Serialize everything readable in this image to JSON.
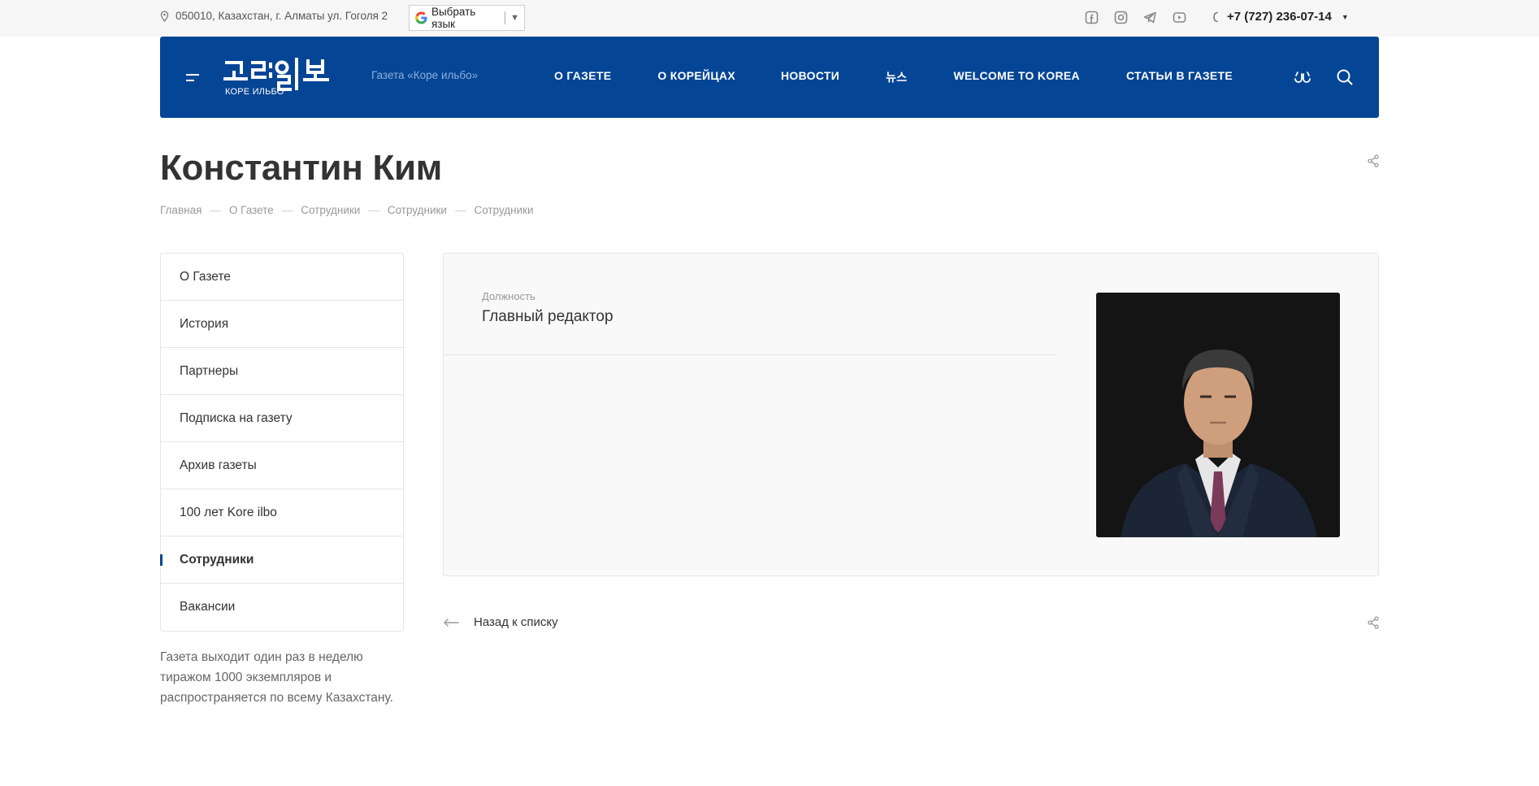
{
  "topbar": {
    "address": "050010, Казахстан, г. Алматы ул. Гоголя 2",
    "language_label": "Выбрать язык",
    "phone": "+7 (727) 236-07-14",
    "social_icons": [
      "facebook-icon",
      "instagram-icon",
      "telegram-icon",
      "youtube-icon"
    ]
  },
  "header": {
    "logo_sub": "КОРЕ ИЛЬБО",
    "tagline": "Газета «Коре ильбо»",
    "menu": [
      {
        "label": "О ГАЗЕТЕ"
      },
      {
        "label": "О КОРЕЙЦАХ"
      },
      {
        "label": "НОВОСТИ"
      },
      {
        "label": "뉴스"
      },
      {
        "label": "WELCOME TO KOREA"
      },
      {
        "label": "СТАТЬИ В ГАЗЕТЕ"
      }
    ]
  },
  "page": {
    "title": "Константин Ким",
    "breadcrumb": [
      "Главная",
      "О Газете",
      "Сотрудники",
      "Сотрудники",
      "Сотрудники"
    ]
  },
  "sidebar": {
    "items": [
      {
        "label": "О Газете"
      },
      {
        "label": "История"
      },
      {
        "label": "Партнеры"
      },
      {
        "label": "Подписка на газету"
      },
      {
        "label": "Архив газеты"
      },
      {
        "label": "100 лет Kore ilbo"
      },
      {
        "label": "Сотрудники",
        "active": true
      },
      {
        "label": "Вакансии"
      }
    ],
    "note": "Газета выходит один раз в неделю тиражом 1000 экземпляров и распространяется по всему Казахстану."
  },
  "detail": {
    "position_label": "Должность",
    "position_value": "Главный редактор"
  },
  "footer_nav": {
    "back_label": "Назад к списку"
  },
  "colors": {
    "brand": "#044595",
    "tagline": "#8fb0db",
    "topbar_bg": "#f6f6f6"
  }
}
